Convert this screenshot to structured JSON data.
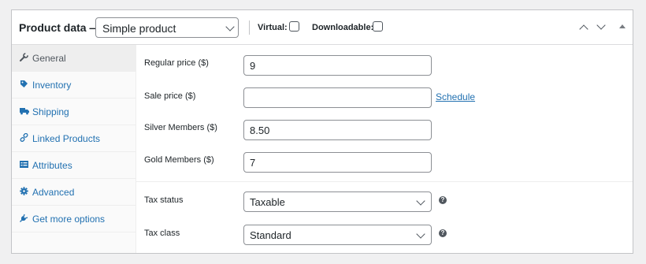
{
  "header": {
    "title": "Product data —",
    "product_type": "Simple product",
    "virtual_label": "Virtual:",
    "virtual_checked": false,
    "downloadable_label": "Downloadable:",
    "downloadable_checked": false
  },
  "sidebar": {
    "items": [
      {
        "label": "General",
        "icon": "wrench-icon",
        "active": true
      },
      {
        "label": "Inventory",
        "icon": "tag-icon",
        "active": false
      },
      {
        "label": "Shipping",
        "icon": "truck-icon",
        "active": false
      },
      {
        "label": "Linked Products",
        "icon": "link-icon",
        "active": false
      },
      {
        "label": "Attributes",
        "icon": "list-icon",
        "active": false
      },
      {
        "label": "Advanced",
        "icon": "gear-icon",
        "active": false
      },
      {
        "label": "Get more options",
        "icon": "plugin-icon",
        "active": false
      }
    ]
  },
  "fields": {
    "regular_price": {
      "label": "Regular price ($)",
      "value": "9"
    },
    "sale_price": {
      "label": "Sale price ($)",
      "value": ""
    },
    "schedule_link": "Schedule",
    "silver_members": {
      "label": "Silver Members ($)",
      "value": "8.50"
    },
    "gold_members": {
      "label": "Gold Members ($)",
      "value": "7"
    },
    "tax_status": {
      "label": "Tax status",
      "value": "Taxable"
    },
    "tax_class": {
      "label": "Tax class",
      "value": "Standard"
    }
  },
  "colors": {
    "link": "#2271b1",
    "border": "#8c8f94",
    "background": "#f0f0f1"
  }
}
